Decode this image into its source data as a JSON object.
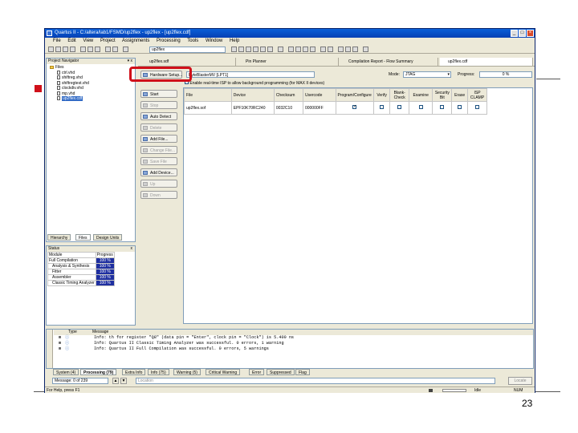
{
  "window": {
    "title": "Quartus II - C:/altera/lab1/FSMD/up2flex - up2flex - [up2flex.cdf]",
    "controls": [
      "_",
      "□",
      "×"
    ]
  },
  "menu": [
    "File",
    "Edit",
    "View",
    "Project",
    "Assignments",
    "Processing",
    "Tools",
    "Window",
    "Help"
  ],
  "toolbar": {
    "entity_combo": "up2flex"
  },
  "navigator": {
    "title": "Project Navigator",
    "header_glyphs": "▾ x",
    "root": "Files",
    "files": [
      "ctrl.vhd",
      "shiftreg.vhd",
      "shiftregtest.vhd",
      "clockdiv.vhd",
      "mp.vhd",
      "up2flex.cdf"
    ],
    "tabs": [
      "Hierarchy",
      "Files",
      "Design Units"
    ]
  },
  "status_panel": {
    "title": "Status",
    "header_glyph": "x",
    "col_module": "Module",
    "col_progress": "Progress",
    "rows": [
      {
        "module": "Full Compilation",
        "progress": "100 %"
      },
      {
        "module": "Analysis & Synthesis",
        "progress": "100 %"
      },
      {
        "module": "Fitter",
        "progress": "100 %"
      },
      {
        "module": "Assembler",
        "progress": "100 %"
      },
      {
        "module": "Classic Timing Analyzer",
        "progress": "100 %"
      }
    ]
  },
  "doc_tabs": [
    "up2flex.sdf",
    "Pin Planner",
    "Compilation Report - Flow Summary",
    "up2flex.cdf"
  ],
  "programmer": {
    "hardware_setup": "Hardware Setup...",
    "hardware_value": "ByteBlasterMV [LPT1]",
    "mode_label": "Mode:",
    "mode_value": "JTAG",
    "progress_label": "Progress:",
    "progress_value": "0 %",
    "enable_realtime": "Enable real-time ISP to allow background programming (for MAX II devices)",
    "side_buttons": [
      {
        "label": "Start",
        "disabled": false
      },
      {
        "label": "Stop",
        "disabled": true
      },
      {
        "label": "Auto Detect",
        "disabled": false
      },
      {
        "label": "Delete",
        "disabled": true
      },
      {
        "label": "Add File...",
        "disabled": false
      },
      {
        "label": "Change File...",
        "disabled": true
      },
      {
        "label": "Save File",
        "disabled": true
      },
      {
        "label": "Add Device...",
        "disabled": false
      },
      {
        "label": "Up",
        "disabled": true
      },
      {
        "label": "Down",
        "disabled": true
      }
    ],
    "columns": [
      "File",
      "Device",
      "Checksum",
      "Usercode",
      "Program/Configure",
      "Verify",
      "Blank-Check",
      "Examine",
      "Security Bit",
      "Erase",
      "ISP CLAMP"
    ],
    "row": {
      "file": "up2flex.sof",
      "device": "EPF10K70RC240",
      "checksum": "0032C10",
      "usercode": "000000FF",
      "program_checked": true
    }
  },
  "messages": {
    "col_type": "Type",
    "col_message": "Message",
    "lines": [
      "Info: th for register \"Q8\" (data pin = \"Enter\", clock pin = \"Clock\") is 5.400 ns",
      "Info: Quartus II Classic Timing Analyzer was successful. 0 errors, 1 warning",
      "Info: Quartus II Full Compilation was successful. 0 errors, 5 warnings"
    ],
    "tabs": [
      "System (4)",
      "Processing (79)",
      "Extra Info",
      "Info (75)",
      "Warning (5)",
      "Critical Warning",
      "Error",
      "Suppressed",
      "Flag"
    ],
    "message_count": "Message: 0 of 239",
    "location_placeholder": "Location",
    "locate_btn": "Locate"
  },
  "statusbar": {
    "help": "For Help, press F1",
    "idle": "Idle",
    "num": "NUM"
  },
  "slide_number": "23",
  "colors": {
    "annotation": "#d0101a",
    "progress_fill": "#1f2fa0",
    "titlebar": "#0a5fd8"
  }
}
